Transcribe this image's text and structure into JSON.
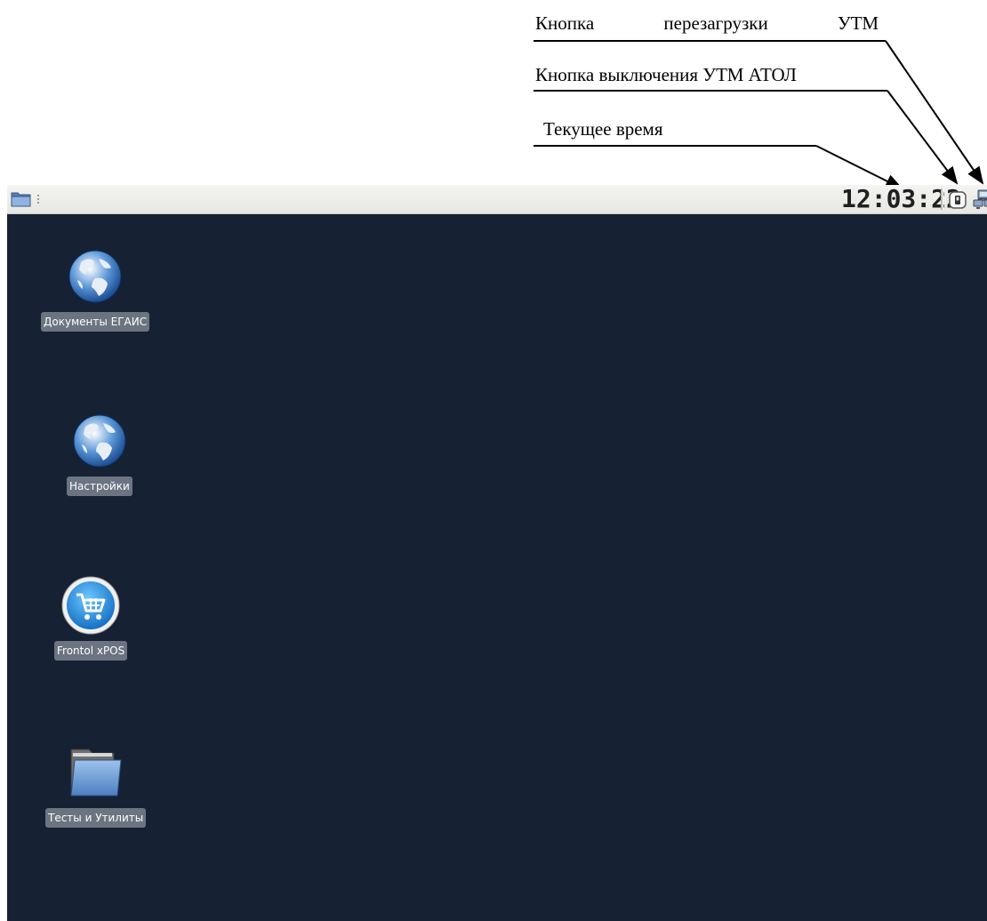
{
  "annotations": {
    "restart": [
      "Кнопка",
      "перезагрузки",
      "УТМ"
    ],
    "shutdown": "Кнопка выключения УТМ АТОЛ",
    "time": "Текущее время"
  },
  "panel": {
    "menu_icon": "folder-icon",
    "clock": "12:03:22",
    "shutdown_icon": "power-switch-icon",
    "restart_icon": "network-restart-icon"
  },
  "desktop": {
    "icons": [
      {
        "label": "Документы ЕГАИС",
        "icon": "globe-icon"
      },
      {
        "label": "Настройки",
        "icon": "globe-icon"
      },
      {
        "label": "Frontol xPOS",
        "icon": "shopping-cart-icon"
      },
      {
        "label": "Тесты и Утилиты",
        "icon": "folder-icon"
      }
    ]
  },
  "colors": {
    "desktop_bg": "#162133",
    "panel_bg": "#eeeeea",
    "label_bg": "#6b7480"
  }
}
